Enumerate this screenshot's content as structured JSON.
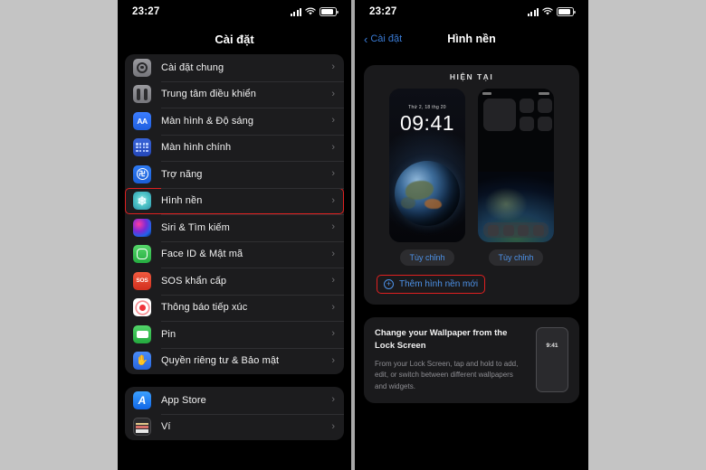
{
  "background_color": "#c4c4c4",
  "left_phone": {
    "status_bar": {
      "time": "23:27",
      "signal_icon": "signal-bars-icon",
      "wifi_icon": "wifi-icon",
      "battery_icon": "battery-icon"
    },
    "nav_title": "Cài đặt",
    "groups": [
      {
        "rows": [
          {
            "label": "Cài đặt chung",
            "icon": "gear-icon",
            "chevron": "›",
            "highlighted": false
          },
          {
            "label": "Trung tâm điều khiển",
            "icon": "control-center-icon",
            "chevron": "›",
            "highlighted": false
          },
          {
            "label": "Màn hình & Độ sáng",
            "icon": "display-aa-icon",
            "chevron": "›",
            "highlighted": false
          },
          {
            "label": "Màn hình chính",
            "icon": "home-screen-icon",
            "chevron": "›",
            "highlighted": false
          },
          {
            "label": "Trợ năng",
            "icon": "accessibility-icon",
            "chevron": "›",
            "highlighted": false
          },
          {
            "label": "Hình nền",
            "icon": "wallpaper-icon",
            "chevron": "›",
            "highlighted": true
          },
          {
            "label": "Siri & Tìm kiếm",
            "icon": "siri-icon",
            "chevron": "›",
            "highlighted": false
          },
          {
            "label": "Face ID & Mật mã",
            "icon": "face-id-icon",
            "chevron": "›",
            "highlighted": false
          },
          {
            "label": "SOS khẩn cấp",
            "icon": "sos-icon",
            "chevron": "›",
            "highlighted": false
          },
          {
            "label": "Thông báo tiếp xúc",
            "icon": "exposure-icon",
            "chevron": "›",
            "highlighted": false
          },
          {
            "label": "Pin",
            "icon": "battery-settings-icon",
            "chevron": "›",
            "highlighted": false
          },
          {
            "label": "Quyền riêng tư & Bảo mật",
            "icon": "privacy-hand-icon",
            "chevron": "›",
            "highlighted": false
          }
        ]
      },
      {
        "rows": [
          {
            "label": "App Store",
            "icon": "app-store-icon",
            "chevron": "›",
            "highlighted": false
          },
          {
            "label": "Ví",
            "icon": "wallet-icon",
            "chevron": "›",
            "highlighted": false
          }
        ]
      }
    ],
    "icon_labels": {
      "aa": "AA",
      "sos": "SOS",
      "app_store": "A",
      "privacy": "✋",
      "accessibility": "࿖",
      "wallpaper": "❄"
    }
  },
  "right_phone": {
    "status_bar": {
      "time": "23:27",
      "signal_icon": "signal-bars-icon",
      "wifi_icon": "wifi-icon",
      "battery_icon": "battery-icon"
    },
    "nav": {
      "back_label": "Cài đặt",
      "back_carat": "‹",
      "title": "Hình nền"
    },
    "current_section": {
      "header": "HIỆN TẠI",
      "lock_preview": {
        "date": "Thứ 2, 18 thg 20",
        "time": "09:41",
        "customize_label": "Tùy chỉnh"
      },
      "home_preview": {
        "customize_label": "Tùy chỉnh"
      }
    },
    "add_wallpaper": {
      "label": "Thêm hình nền mới",
      "icon": "plus-circle-icon",
      "highlighted": true
    },
    "tip_card": {
      "title": "Change your Wallpaper from the Lock Screen",
      "body": "From your Lock Screen, tap and hold to add, edit, or switch between different wallpapers and widgets.",
      "phone_time": "9:41"
    }
  },
  "accents": {
    "highlight_red": "#e02020",
    "link_blue": "#4d92e8",
    "back_blue": "#3a7bd5",
    "card_bg": "#1a1a1c",
    "row_bg": "#1c1c1e"
  }
}
